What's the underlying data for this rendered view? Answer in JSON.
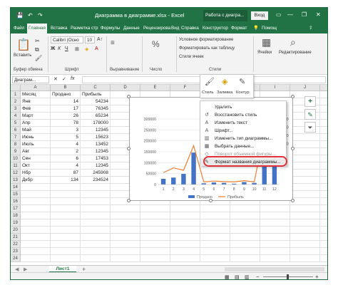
{
  "window": {
    "title": "Диаграмма в диаграмме.xlsx  -  Excel",
    "context_title": "Работа с диагра...",
    "signin_label": "Вход",
    "save_icon": "💾",
    "undo_icon": "↶",
    "redo_icon": "↷",
    "minimize": "—",
    "restore": "❐",
    "close": "✕"
  },
  "tabs": [
    {
      "label": "Файл"
    },
    {
      "label": "Главная"
    },
    {
      "label": "Вставка"
    },
    {
      "label": "Разметка стр"
    },
    {
      "label": "Формулы"
    },
    {
      "label": "Данные"
    },
    {
      "label": "Рецензирова"
    },
    {
      "label": "Вид"
    },
    {
      "label": "Справка"
    },
    {
      "label": "Конструктор"
    },
    {
      "label": "Формат"
    },
    {
      "label": "Помощ"
    }
  ],
  "ribbon": {
    "paste_label": "Вставить",
    "clipboard_group": "Буфер обмена",
    "font_name": "Calibri (Осно",
    "font_size": "10",
    "bold": "Ж",
    "italic": "К",
    "underline": "Ч",
    "font_group": "Шрифт",
    "alignment_group": "Выравнивание",
    "number_label": "%",
    "number_group": "Число",
    "cond_format": "Условное форматирование",
    "format_table": "Форматировать как таблицу",
    "cell_styles": "Стили ячеек",
    "styles_group": "Стили",
    "cells_label": "Ячейки",
    "editing_label": "Редактирование"
  },
  "formula_bar": {
    "name_box": "Диаграм...",
    "fx": "fx"
  },
  "columns": [
    "A",
    "B",
    "C",
    "D",
    "E",
    "F",
    "G",
    "H",
    "I",
    "J",
    "K",
    "L"
  ],
  "rows": [
    "1",
    "2",
    "3",
    "4",
    "5",
    "6",
    "7",
    "8",
    "9",
    "10",
    "11",
    "12",
    "13",
    "14",
    "15",
    "16",
    "17",
    "18",
    "19",
    "20",
    "21",
    "22",
    "23",
    "24"
  ],
  "table": {
    "headers": [
      "Месяц",
      "Продано",
      "Прибыль"
    ],
    "data": [
      [
        "Янв",
        "14",
        "54234"
      ],
      [
        "Фев",
        "17",
        "76345"
      ],
      [
        "Март",
        "26",
        "65234"
      ],
      [
        "Апр",
        "78",
        "178000"
      ],
      [
        "Май",
        "3",
        "12345"
      ],
      [
        "Июнь",
        "5",
        "15623"
      ],
      [
        "Июль",
        "4",
        "13452"
      ],
      [
        "Авг",
        "2",
        "12345"
      ],
      [
        "Сен",
        "6",
        "17453"
      ],
      [
        "Окт",
        "4",
        "12345"
      ],
      [
        "Нбр",
        "87",
        "245908"
      ],
      [
        "Дкбр",
        "134",
        "234524"
      ]
    ]
  },
  "minibar": {
    "style_label": "Стиль",
    "fill_label": "Заливка",
    "outline_label": "Контур"
  },
  "context_menu": {
    "items": [
      {
        "label": "Удалить",
        "icon": "",
        "disabled": false
      },
      {
        "label": "Восстановить стиль",
        "icon": "↺",
        "disabled": false
      },
      {
        "label": "Изменить текст",
        "icon": "A",
        "disabled": false
      },
      {
        "label": "Шрифт...",
        "icon": "A",
        "disabled": false
      },
      {
        "label": "Изменить тип диаграммы...",
        "icon": "▥",
        "disabled": false
      },
      {
        "label": "Выбрать данные...",
        "icon": "▦",
        "disabled": false
      },
      {
        "label": "Поворот объемной фигуры...",
        "icon": "◇",
        "disabled": true
      },
      {
        "label": "Формат названия диаграммы...",
        "icon": "✎",
        "disabled": false
      }
    ]
  },
  "sheet": {
    "tab_label": "Лист1",
    "add_icon": "+"
  },
  "accent": "#217346",
  "highlight": "#e0303a",
  "chart_data": {
    "type": "bar",
    "categories": [
      "1",
      "2",
      "3",
      "4",
      "5",
      "6",
      "7",
      "8",
      "9",
      "10",
      "11",
      "12"
    ],
    "series": [
      {
        "name": "Продано",
        "kind": "bar",
        "axis": "secondary",
        "color": "#4472c4",
        "values": [
          14,
          17,
          26,
          78,
          3,
          5,
          4,
          2,
          6,
          4,
          87,
          134
        ]
      },
      {
        "name": "Прибыль",
        "kind": "line",
        "axis": "primary",
        "color": "#ed7d31",
        "values": [
          54234,
          76345,
          65234,
          178000,
          12345,
          15623,
          13452,
          12345,
          17453,
          12345,
          245908,
          234524
        ]
      }
    ],
    "primary_ticks": [
      "300000",
      "250000",
      "200000",
      "150000",
      "100000",
      "50000",
      "0"
    ],
    "primary_ylim": [
      0,
      300000
    ],
    "secondary_ticks": [
      "160",
      "140",
      "120",
      "100"
    ],
    "secondary_ylim": [
      0,
      160
    ],
    "legend": "bottom"
  }
}
